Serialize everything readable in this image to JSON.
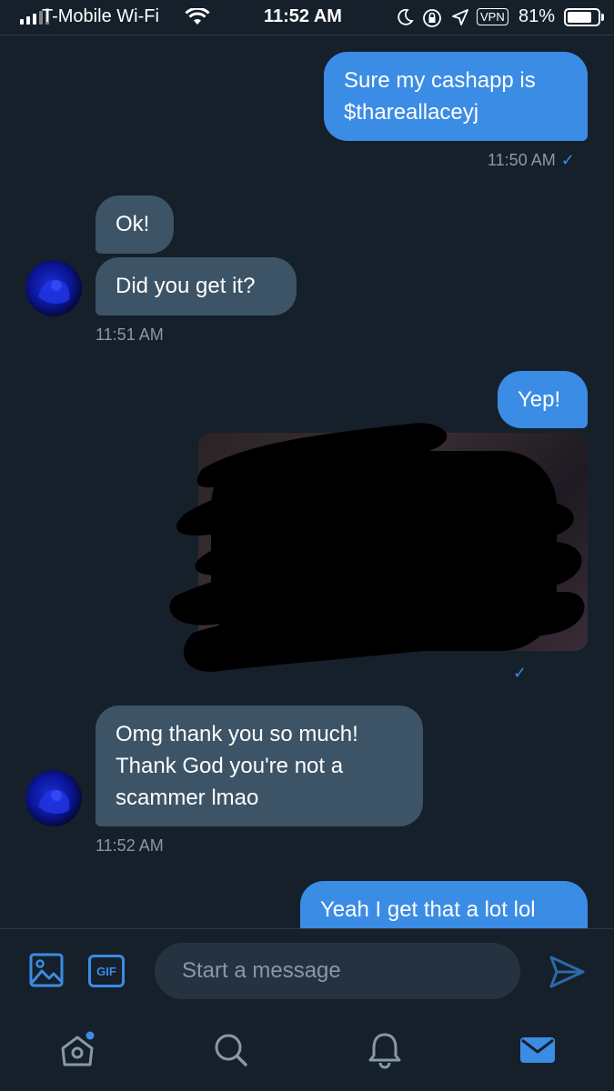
{
  "status_bar": {
    "carrier": "T-Mobile Wi-Fi",
    "time": "11:52 AM",
    "vpn": "VPN",
    "battery": "81%",
    "battery_level": 0.81,
    "icons": [
      "signal-icon",
      "wifi-icon",
      "moon-icon",
      "rotation-lock-icon",
      "location-icon",
      "vpn-badge",
      "battery-icon"
    ]
  },
  "messages": [
    {
      "side": "sent",
      "lines": [
        "Sure my cashapp is",
        "$thareallaceyj"
      ]
    },
    {
      "timestamp": "11:50 AM",
      "checkmark": "✓"
    },
    {
      "side": "received",
      "lines": [
        "Ok!"
      ]
    },
    {
      "side": "received",
      "lines": [
        "Did you get it?"
      ]
    },
    {
      "timestamp": "11:51 AM"
    },
    {
      "side": "sent",
      "lines": [
        "Yep!"
      ]
    },
    {
      "side": "sent",
      "media": "redacted-image"
    },
    {
      "side": "received",
      "lines": [
        "Omg thank you so much!",
        "Thank God you're not a",
        "scammer lmao"
      ]
    },
    {
      "timestamp": "11:52 AM"
    },
    {
      "side": "sent",
      "lines": [
        "Yeah I get that a lot lol"
      ]
    }
  ],
  "text": {
    "m1_l1": "Sure my cashapp is",
    "m1_l2": "$thareallaceyj",
    "ts1": "11:50 AM",
    "check": "✓",
    "m2": "Ok!",
    "m3": "Did you get it?",
    "ts2": "11:51 AM",
    "m4": "Yep!",
    "m5_l1": "Omg thank you so much!",
    "m5_l2": "Thank God you're not a",
    "m5_l3": "scammer lmao",
    "ts3": "11:52 AM",
    "m6": "Yeah I get that a lot lol"
  },
  "composer": {
    "placeholder": "Start a message",
    "gif_label": "GIF",
    "icons": [
      "image-icon",
      "gif-icon",
      "send-icon"
    ]
  },
  "tabbar": {
    "icons": [
      "home-icon",
      "search-icon",
      "notifications-icon",
      "messages-icon"
    ],
    "active": "messages-icon",
    "has_home_dot": true
  },
  "colors": {
    "background": "#15202b",
    "sent_bubble": "#3b8ce4",
    "received_bubble": "#3d5466",
    "muted_text": "#8899a6",
    "accent": "#3b8ce4"
  }
}
